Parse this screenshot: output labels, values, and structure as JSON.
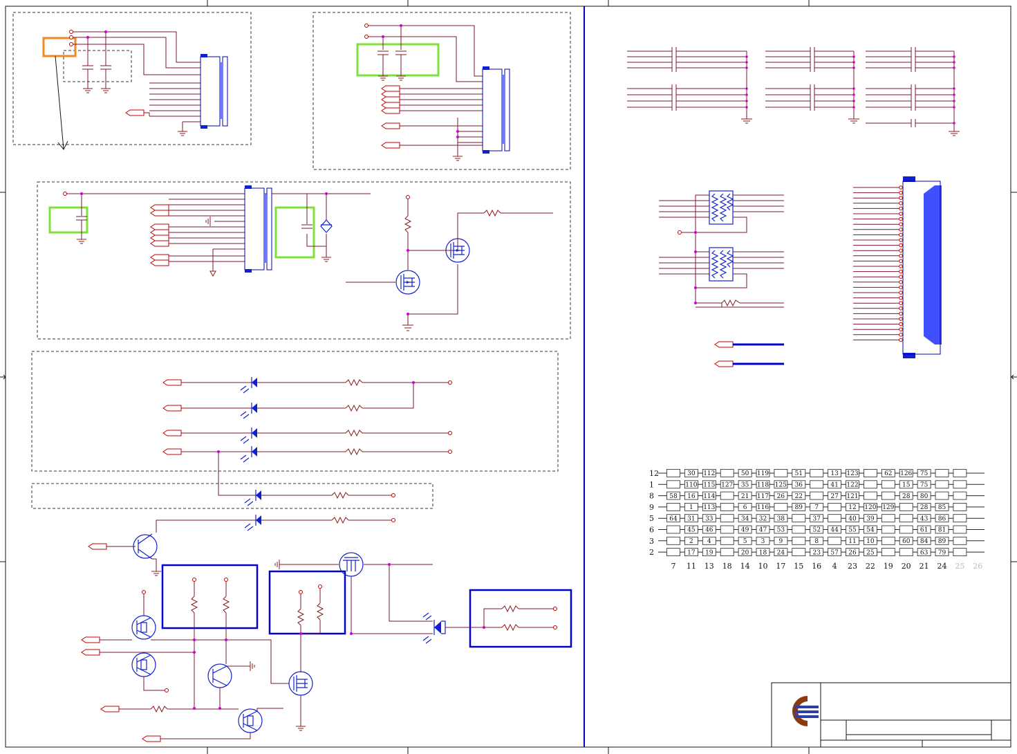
{
  "matrix": {
    "rows": [
      "12",
      "1",
      "8",
      "9",
      "5",
      "6",
      "3",
      "2"
    ],
    "columns": [
      "7",
      "11",
      "13",
      "18",
      "14",
      "10",
      "17",
      "15",
      "16",
      "4",
      "23",
      "22",
      "19",
      "20",
      "21",
      "24",
      "25",
      "26"
    ],
    "faded_columns": [
      "25",
      "26"
    ],
    "cells": [
      [
        "",
        "30",
        "112",
        "",
        "50",
        "119",
        "",
        "51",
        "",
        "13",
        "123",
        "",
        "62",
        "126",
        "75",
        "",
        ""
      ],
      [
        "",
        "110",
        "115",
        "127",
        "35",
        "118",
        "125",
        "36",
        "",
        "41",
        "122",
        "",
        "",
        "15",
        "75",
        "",
        ""
      ],
      [
        "58",
        "16",
        "114",
        "",
        "21",
        "117",
        "26",
        "22",
        "",
        "27",
        "121",
        "",
        "",
        "28",
        "80",
        "",
        ""
      ],
      [
        "",
        "1",
        "113",
        "",
        "6",
        "116",
        "",
        "89",
        "7",
        "",
        "12",
        "120",
        "129",
        "",
        "28",
        "85",
        ""
      ],
      [
        "64",
        "31",
        "33",
        "",
        "34",
        "32",
        "38",
        "",
        "37",
        "",
        "40",
        "39",
        "",
        "",
        "43",
        "86",
        ""
      ],
      [
        "",
        "45",
        "46",
        "",
        "49",
        "47",
        "53",
        "",
        "52",
        "44",
        "55",
        "54",
        "",
        "",
        "61",
        "81",
        ""
      ],
      [
        "",
        "2",
        "4",
        "",
        "5",
        "3",
        "9",
        "",
        "8",
        "",
        "11",
        "10",
        "",
        "60",
        "84",
        "89",
        ""
      ],
      [
        "",
        "17",
        "19",
        "",
        "20",
        "18",
        "24",
        "",
        "23",
        "57",
        "26",
        "25",
        "",
        "",
        "63",
        "79",
        ""
      ]
    ]
  },
  "colors": {
    "wire": "#7a1430",
    "symbol": "#1020d0",
    "junction": "#d000d0",
    "highlight_green": "#7ee03a",
    "highlight_orange": "#ee8a20",
    "logo_brown": "#8a3a10",
    "logo_blue": "#2f3fa8"
  },
  "title_block": {
    "logo": "company-logo"
  }
}
